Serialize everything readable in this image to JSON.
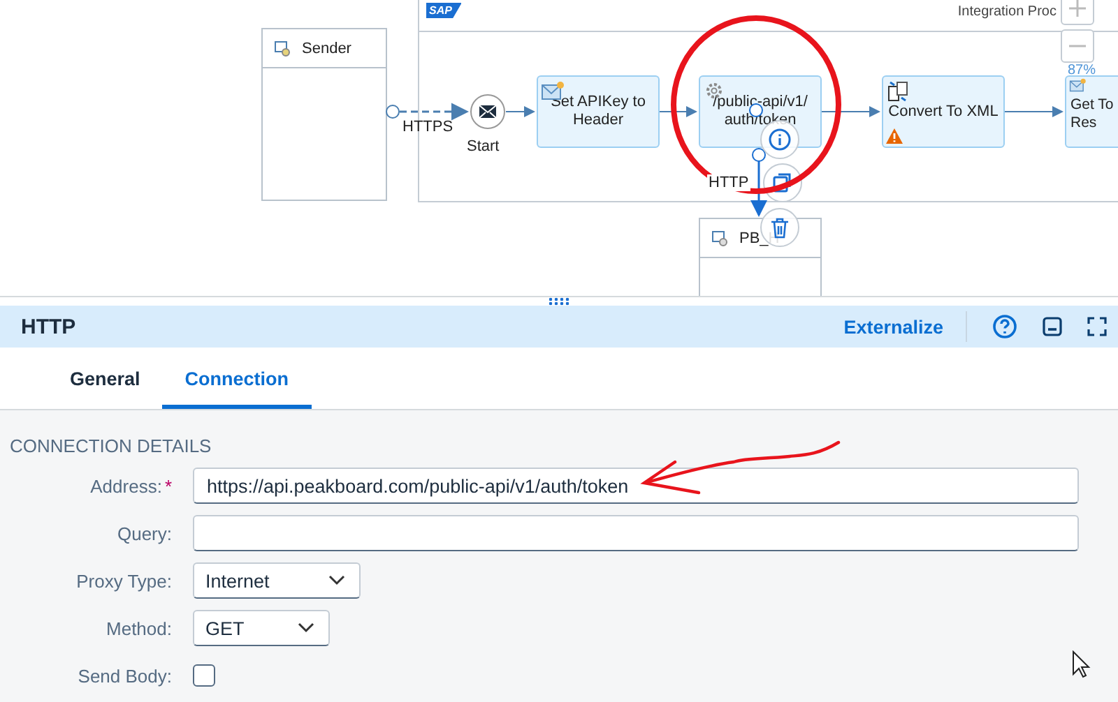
{
  "diagram": {
    "logo": "SAP",
    "process_title": "Integration Proc",
    "zoom_level": "87%",
    "participants": [
      {
        "name": "Sender"
      },
      {
        "name": "PB_H"
      }
    ],
    "steps": [
      {
        "kind": "start-event",
        "label": "Start"
      },
      {
        "kind": "modifier",
        "label": "Set APIKey to Header",
        "warning": false
      },
      {
        "kind": "service",
        "label": "/public-api/v1/\nauth/token",
        "warning": false
      },
      {
        "kind": "converter",
        "label": "Convert To XML",
        "warning": true
      },
      {
        "kind": "modifier",
        "label": "Get To\nRes",
        "warning": false
      }
    ],
    "connections": [
      {
        "label": "HTTPS"
      },
      {
        "label": "HTTP"
      }
    ]
  },
  "panel": {
    "title": "HTTP",
    "action": "Externalize",
    "tabs": [
      {
        "label": "General",
        "selected": false
      },
      {
        "label": "Connection",
        "selected": true
      }
    ],
    "section": "CONNECTION DETAILS",
    "fields": [
      {
        "kind": "text",
        "label": "Address:",
        "required_mark": "*",
        "value": "https://api.peakboard.com/public-api/v1/auth/token"
      },
      {
        "kind": "text",
        "label": "Query:"
      },
      {
        "kind": "select",
        "label": "Proxy Type:",
        "value": "Internet"
      },
      {
        "kind": "select",
        "label": "Method:",
        "value": "GET"
      },
      {
        "kind": "checkbox",
        "label": "Send Body:",
        "checked": false
      }
    ]
  }
}
